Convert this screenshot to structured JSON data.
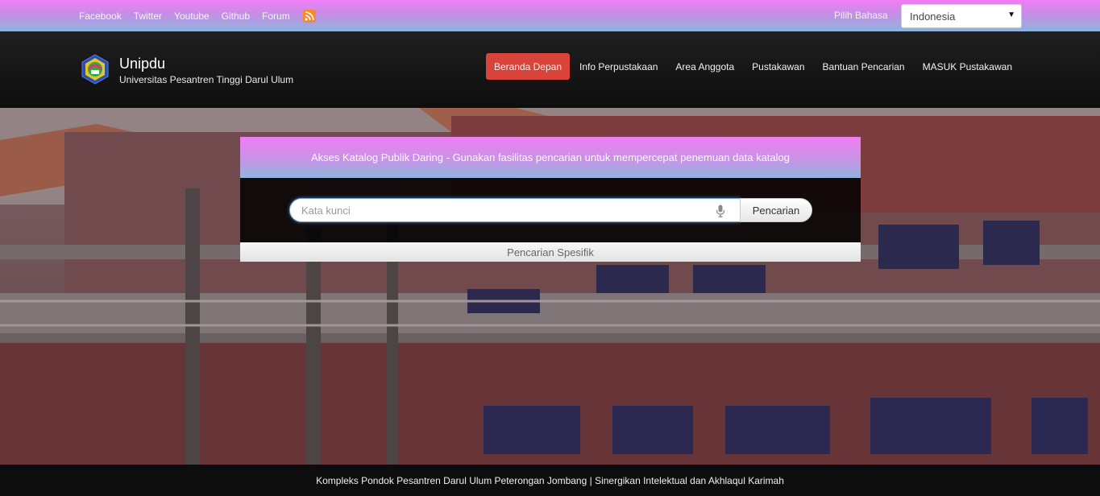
{
  "topbar": {
    "social_links": [
      {
        "label": "Facebook"
      },
      {
        "label": "Twitter"
      },
      {
        "label": "Youtube"
      },
      {
        "label": "Github"
      },
      {
        "label": "Forum"
      }
    ],
    "rss_icon": "rss-icon",
    "language_label": "Pilih Bahasa",
    "language_selected": "Indonesia"
  },
  "header": {
    "site_title": "Unipdu",
    "site_subtitle": "Universitas Pesantren Tinggi Darul Ulum",
    "nav": [
      {
        "label": "Beranda Depan",
        "active": true
      },
      {
        "label": "Info Perpustakaan",
        "active": false
      },
      {
        "label": "Area Anggota",
        "active": false
      },
      {
        "label": "Pustakawan",
        "active": false
      },
      {
        "label": "Bantuan Pencarian",
        "active": false
      },
      {
        "label": "MASUK Pustakawan",
        "active": false
      }
    ]
  },
  "search": {
    "panel_title": "Akses Katalog Publik Daring - Gunakan fasilitas pencarian untuk mempercepat penemuan data katalog",
    "placeholder": "Kata kunci",
    "value": "",
    "button_label": "Pencarian",
    "specific_label": "Pencarian Spesifik"
  },
  "footer": {
    "text": "Kompleks Pondok Pesantren Darul Ulum Peterongan Jombang | Sinergikan Intelektual dan Akhlaqul Karimah"
  },
  "colors": {
    "accent_active_nav": "#d9443a",
    "topbar_gradient_top": "#f07df5",
    "topbar_gradient_bottom": "#8cb5dd"
  }
}
